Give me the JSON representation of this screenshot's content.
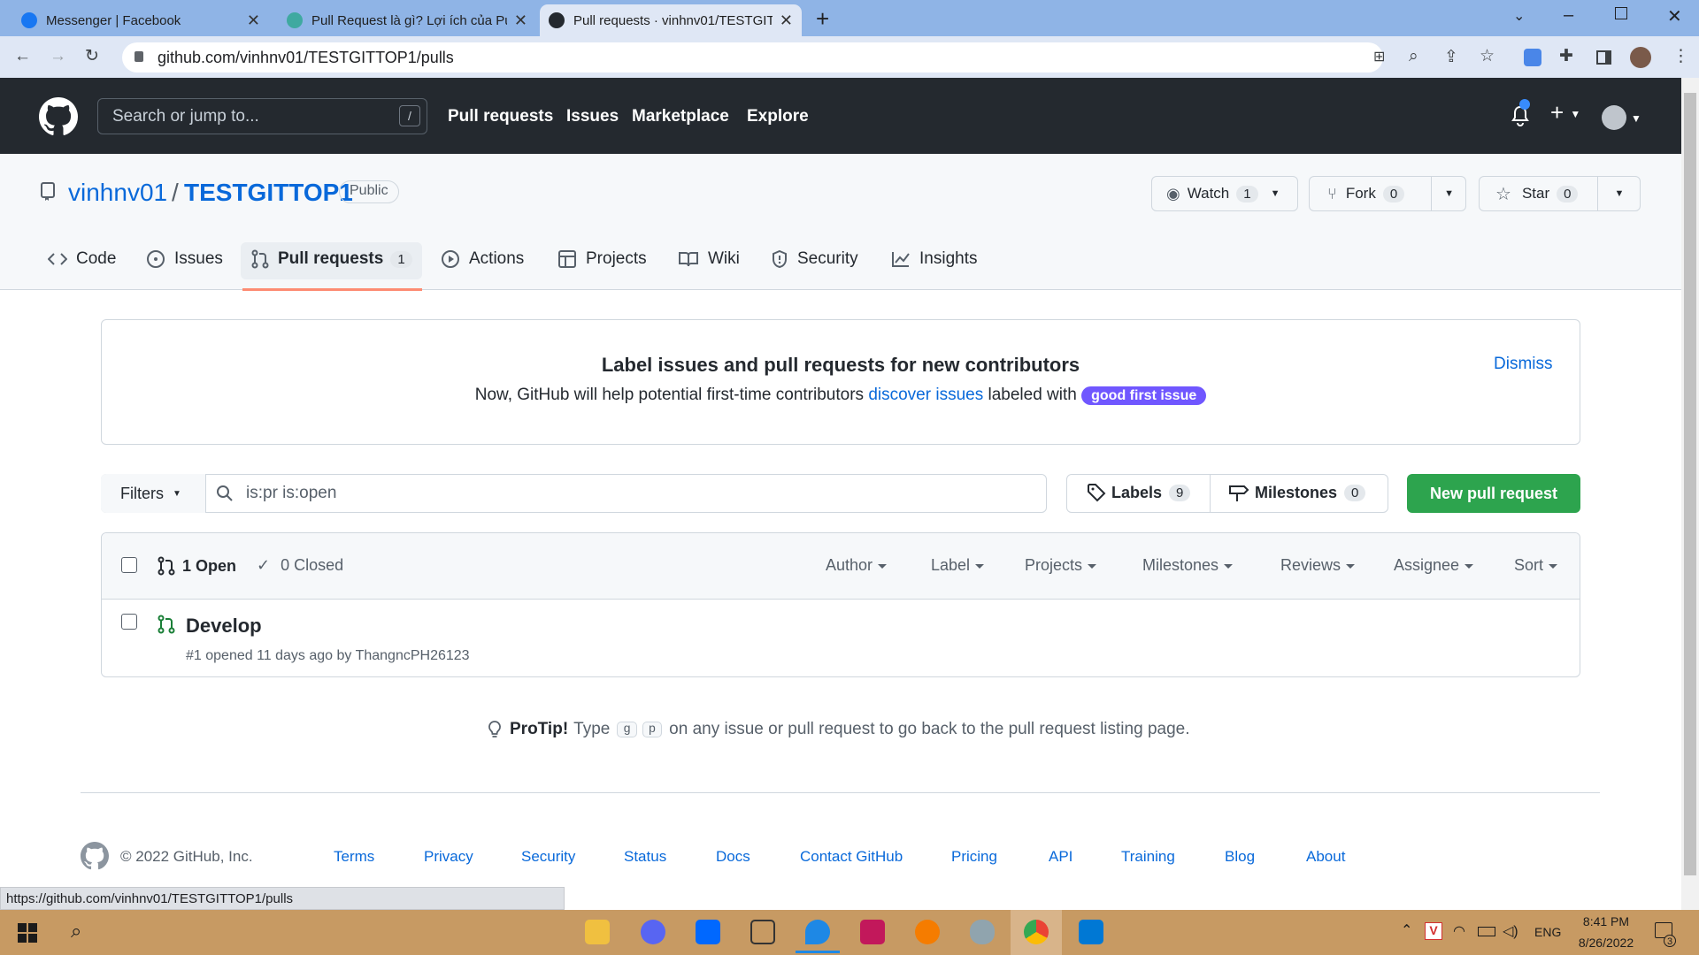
{
  "browser": {
    "tabs": [
      {
        "title": "Messenger | Facebook",
        "favicon": "facebook-icon"
      },
      {
        "title": "Pull Request là gì? Lợi ích của Pul",
        "favicon": "site-icon"
      },
      {
        "title": "Pull requests · vinhnv01/TESTGIT",
        "favicon": "github-icon"
      }
    ],
    "url": "github.com/vinhnv01/TESTGITTOP1/pulls",
    "status_url": "https://github.com/vinhnv01/TESTGITTOP1/pulls"
  },
  "header": {
    "search_placeholder": "Search or jump to...",
    "search_key": "/",
    "nav": [
      "Pull requests",
      "Issues",
      "Marketplace",
      "Explore"
    ]
  },
  "repo": {
    "owner": "vinhnv01",
    "sep": "/",
    "name": "TESTGITTOP1",
    "visibility": "Public",
    "watch": {
      "label": "Watch",
      "count": "1"
    },
    "fork": {
      "label": "Fork",
      "count": "0"
    },
    "star": {
      "label": "Star",
      "count": "0"
    },
    "tabs": [
      {
        "label": "Code"
      },
      {
        "label": "Issues"
      },
      {
        "label": "Pull requests",
        "count": "1"
      },
      {
        "label": "Actions"
      },
      {
        "label": "Projects"
      },
      {
        "label": "Wiki"
      },
      {
        "label": "Security"
      },
      {
        "label": "Insights"
      }
    ]
  },
  "banner": {
    "title": "Label issues and pull requests for new contributors",
    "text_before": "Now, GitHub will help potential first-time contributors",
    "link": "discover issues",
    "text_after": "labeled with",
    "label": "good first issue",
    "dismiss": "Dismiss"
  },
  "filters": {
    "button": "Filters",
    "query": "is:pr is:open",
    "labels": {
      "label": "Labels",
      "count": "9"
    },
    "milestones": {
      "label": "Milestones",
      "count": "0"
    },
    "new_pr": "New pull request"
  },
  "list": {
    "open": "1 Open",
    "closed": "0 Closed",
    "columns": [
      "Author",
      "Label",
      "Projects",
      "Milestones",
      "Reviews",
      "Assignee",
      "Sort"
    ],
    "items": [
      {
        "title": "Develop",
        "meta": "#1 opened 11 days ago by ThangncPH26123"
      }
    ]
  },
  "protip": {
    "strong": "ProTip!",
    "type": "Type",
    "key1": "g",
    "key2": "p",
    "rest": "on any issue or pull request to go back to the pull request listing page."
  },
  "footer": {
    "copyright": "© 2022 GitHub, Inc.",
    "links": [
      "Terms",
      "Privacy",
      "Security",
      "Status",
      "Docs",
      "Contact GitHub",
      "Pricing",
      "API",
      "Training",
      "Blog",
      "About"
    ]
  },
  "taskbar": {
    "lang": "ENG",
    "time": "8:41 PM",
    "date": "8/26/2022",
    "notifications": "3"
  },
  "colors": {
    "accent": "#0969da",
    "green": "#2da44e",
    "tab_underline": "#fd8c73",
    "header_bg": "#24292f"
  }
}
